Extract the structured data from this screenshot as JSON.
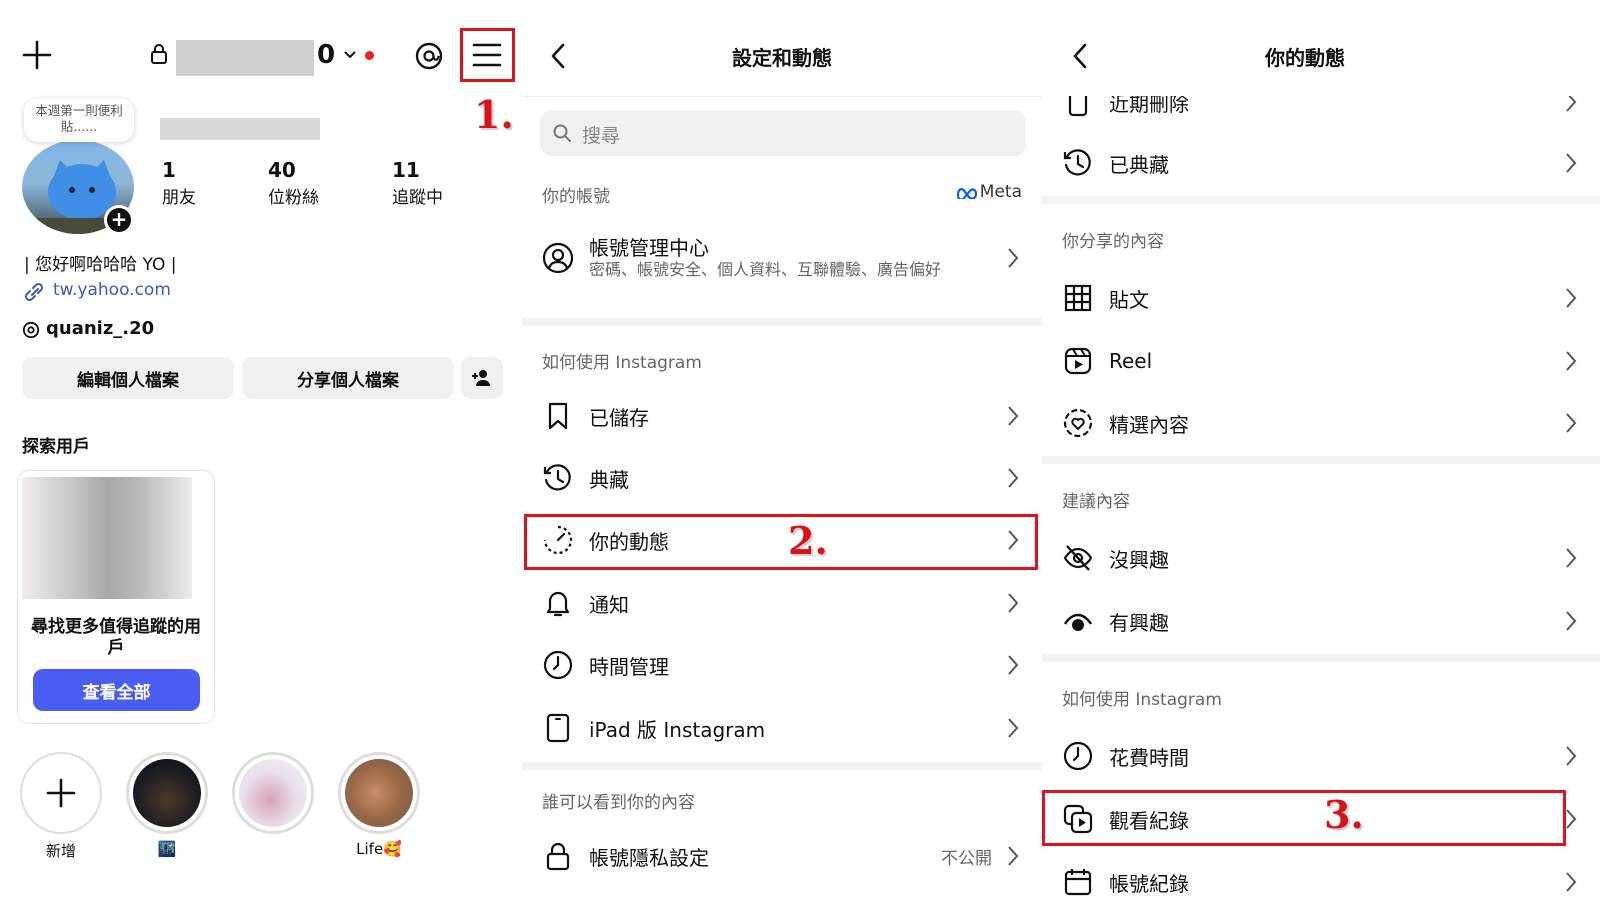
{
  "panel1": {
    "username_suffix": "0",
    "note_bubble": "本週第一則便利貼......",
    "stats": [
      {
        "value": "1",
        "label": "朋友"
      },
      {
        "value": "40",
        "label": "位粉絲"
      },
      {
        "value": "11",
        "label": "追蹤中"
      }
    ],
    "bio": "| 您好啊哈哈哈 YO |",
    "link": "tw.yahoo.com",
    "threads_handle": "quaniz_.20",
    "edit_profile": "編輯個人檔案",
    "share_profile": "分享個人檔案",
    "discover_title": "探索用戶",
    "discover_card_text": "尋找更多值得追蹤的用戶",
    "see_all": "查看全部",
    "stories": [
      {
        "label": "新增"
      },
      {
        "label": "🌃"
      },
      {
        "label": ""
      },
      {
        "label": "Life🥰"
      }
    ],
    "step_label": "1."
  },
  "panel2": {
    "title": "設定和動態",
    "search_placeholder": "搜尋",
    "your_account": "你的帳號",
    "meta_label": "Meta",
    "account_center": {
      "title": "帳號管理中心",
      "subtitle": "密碼、帳號安全、個人資料、互聯體驗、廣告偏好"
    },
    "how_to_use": "如何使用 Instagram",
    "rows": [
      {
        "label": "已儲存",
        "icon": "bookmark-icon"
      },
      {
        "label": "典藏",
        "icon": "archive-history-icon"
      },
      {
        "label": "你的動態",
        "icon": "activity-icon"
      },
      {
        "label": "通知",
        "icon": "bell-icon"
      },
      {
        "label": "時間管理",
        "icon": "clock-icon"
      },
      {
        "label": "iPad 版 Instagram",
        "icon": "tablet-icon"
      }
    ],
    "who_can_see": "誰可以看到你的內容",
    "privacy": {
      "label": "帳號隱私設定",
      "value": "不公開"
    },
    "step_label": "2."
  },
  "panel3": {
    "title": "你的動態",
    "top_cut_row": "近期刪除",
    "archived": "已典藏",
    "shared_section": "你分享的內容",
    "shared_rows": [
      {
        "label": "貼文",
        "icon": "grid-icon"
      },
      {
        "label": "Reel",
        "icon": "reels-icon"
      },
      {
        "label": "精選內容",
        "icon": "highlights-icon"
      }
    ],
    "suggested_section": "建議內容",
    "suggested_rows": [
      {
        "label": "沒興趣",
        "icon": "eye-off-icon"
      },
      {
        "label": "有興趣",
        "icon": "eye-icon"
      }
    ],
    "how_to_use": "如何使用 Instagram",
    "usage_rows": [
      {
        "label": "花費時間",
        "icon": "clock-icon"
      },
      {
        "label": "觀看紀錄",
        "icon": "watch-history-icon"
      },
      {
        "label": "帳號紀錄",
        "icon": "calendar-icon"
      }
    ],
    "step_label": "3."
  },
  "colors": {
    "accent_blue": "#4a5df0",
    "highlight_red": "#e0121b",
    "link_blue": "#3b5bab"
  }
}
